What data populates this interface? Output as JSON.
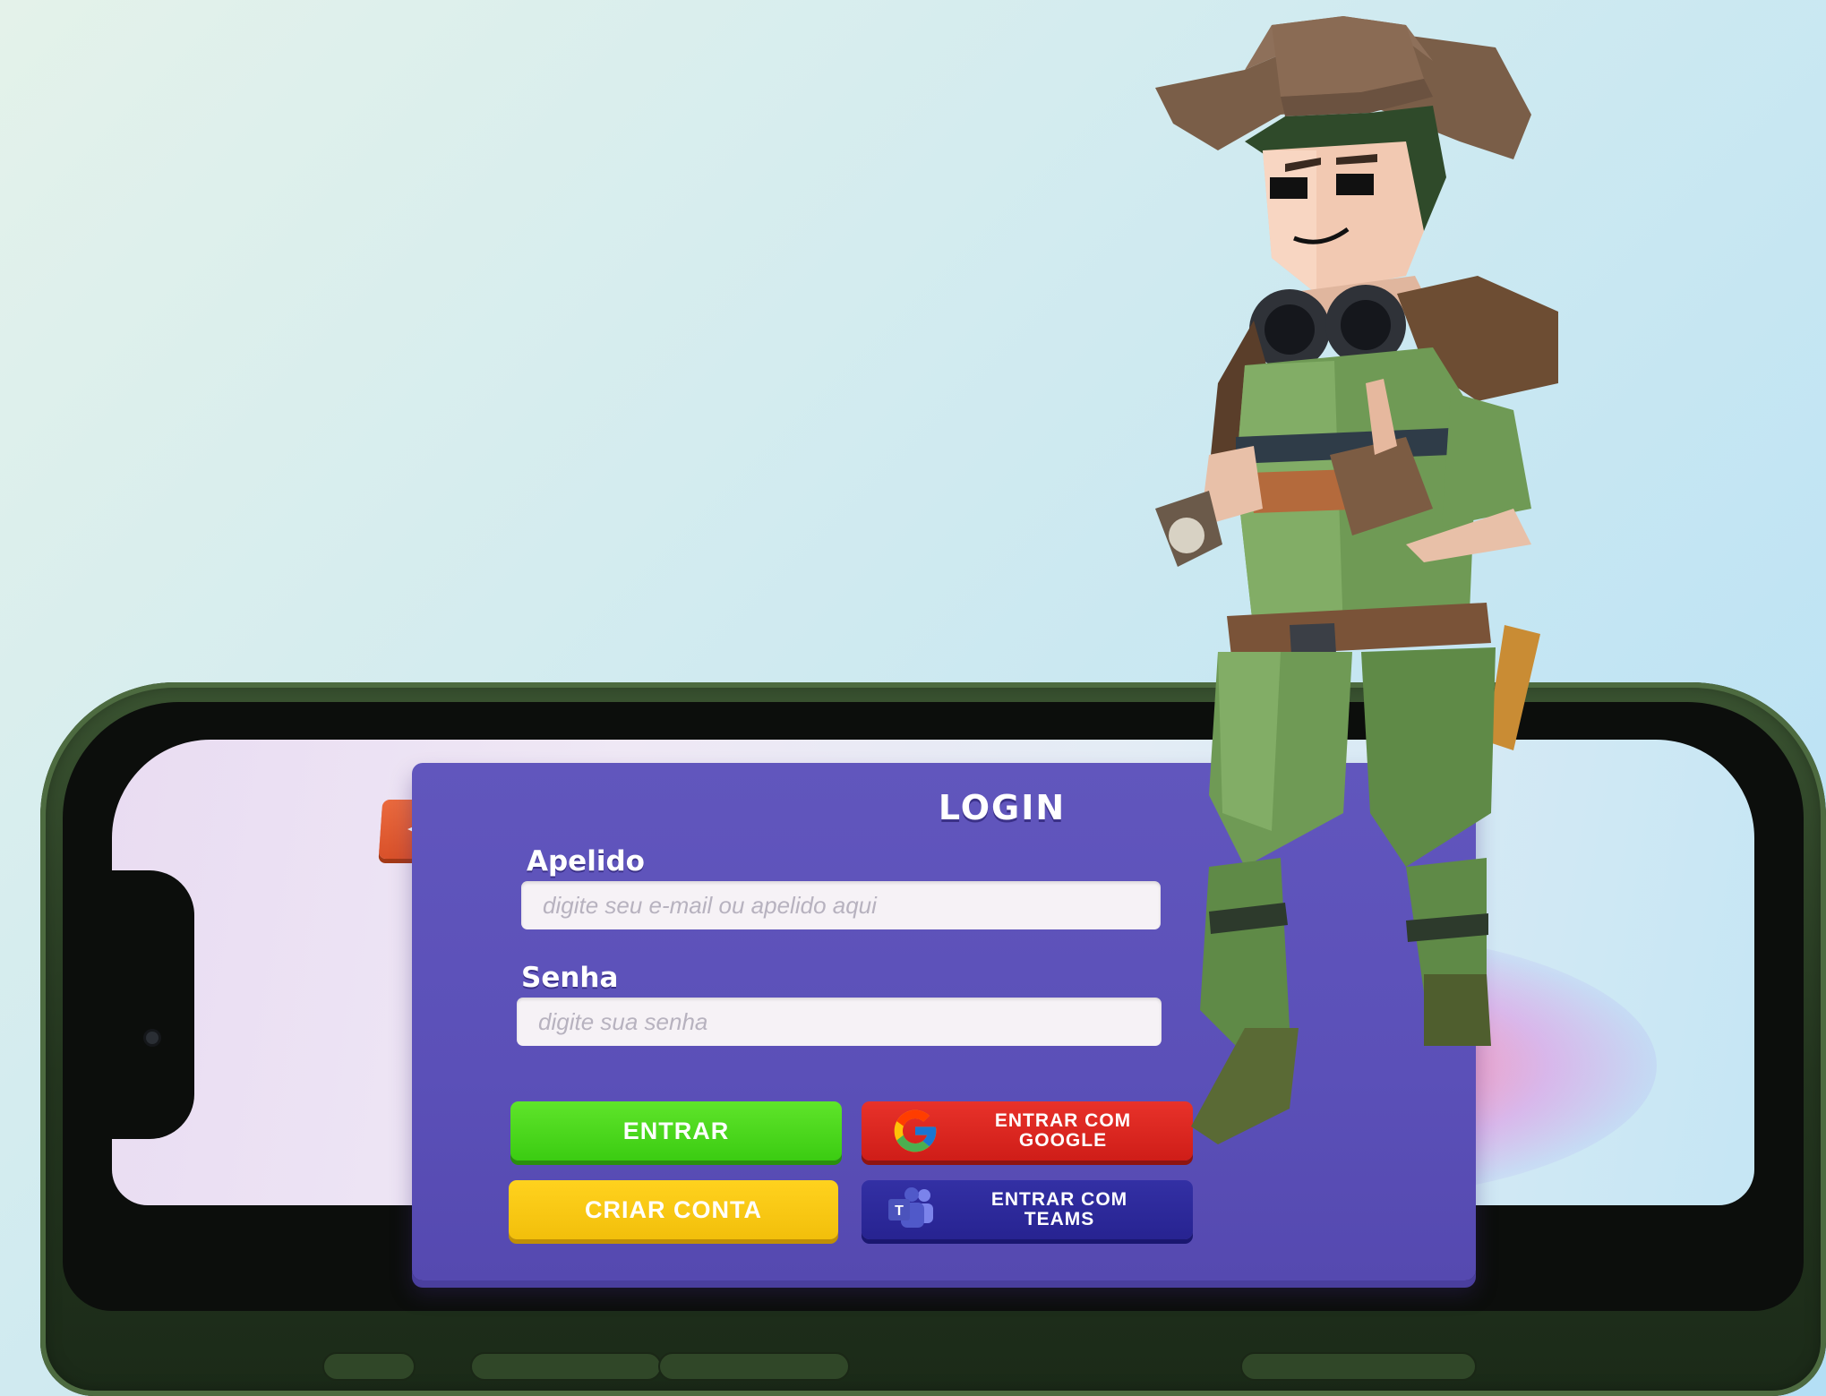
{
  "login": {
    "title": "LOGIN",
    "nickname_label": "Apelido",
    "nickname_placeholder": "digite seu e-mail ou apelido aqui",
    "password_label": "Senha",
    "password_placeholder": "digite sua senha",
    "enter_button": "ENTRAR",
    "create_account_button": "CRIAR CONTA",
    "google_button_line1": "ENTRAR COM",
    "google_button_line2": "GOOGLE",
    "teams_button_line1": "ENTRAR COM",
    "teams_button_line2": "TEAMS"
  },
  "icons": {
    "back": "back-arrow-icon",
    "google": "google-icon",
    "teams": "teams-icon"
  },
  "colors": {
    "panel": "#5f54bb",
    "enter": "#4cd81e",
    "create": "#f8c814",
    "google": "#dc2820",
    "teams": "#2d2a9c",
    "back": "#e05c32",
    "phone": "#2f4727"
  }
}
